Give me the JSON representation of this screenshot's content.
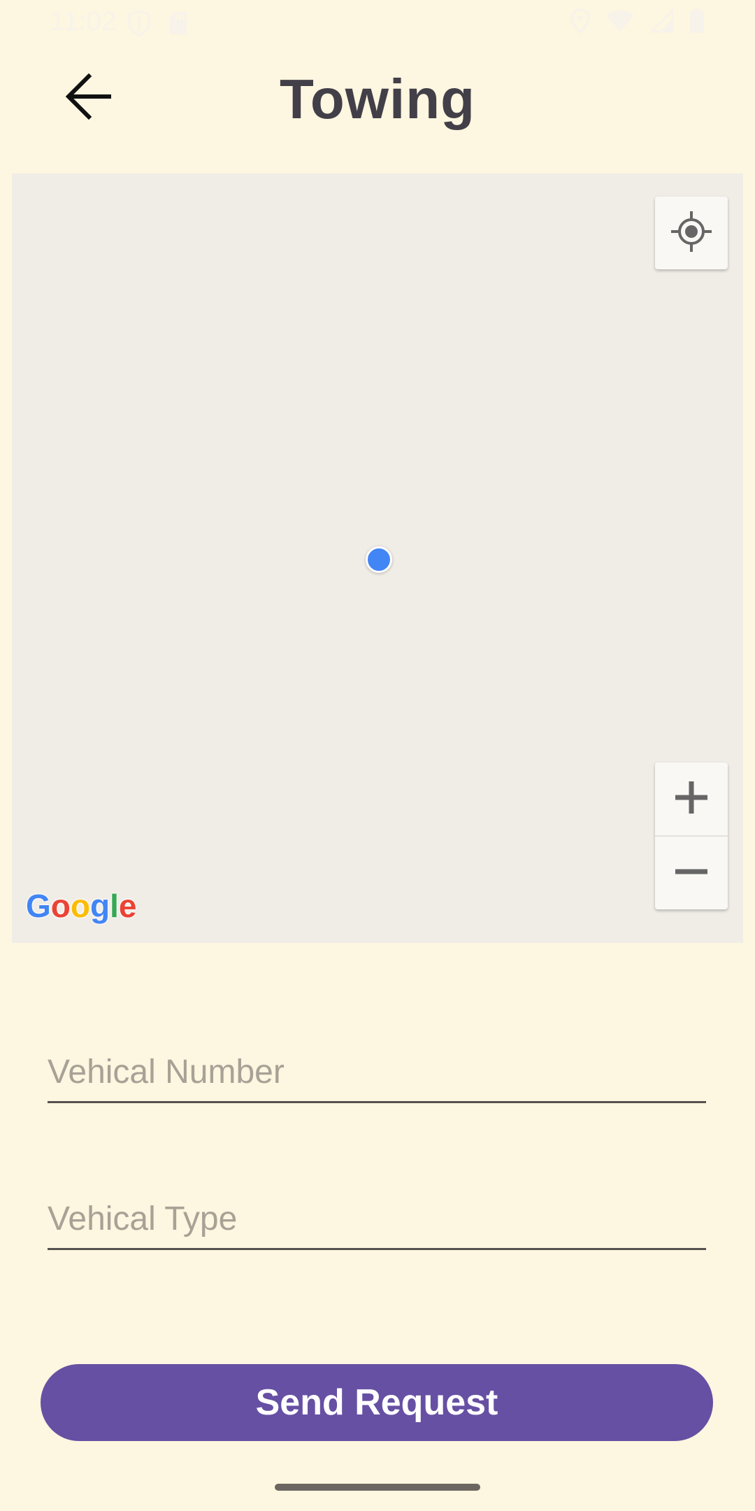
{
  "status_bar": {
    "time": "11:02",
    "left_icons": [
      "shield-icon",
      "sd-card-icon"
    ],
    "right_icons": [
      "location-pin-icon",
      "wifi-icon",
      "signal-icon",
      "battery-icon"
    ]
  },
  "app_bar": {
    "back_icon": "arrow-back-icon",
    "title": "Towing"
  },
  "map": {
    "my_location_icon": "crosshair-icon",
    "zoom_in_icon": "plus-icon",
    "zoom_out_icon": "minus-icon",
    "logo_text": "Google",
    "user_dot_color": "#4285F4",
    "background_color": "#F0EDE6"
  },
  "form": {
    "vehicle_number": {
      "placeholder": "Vehical Number",
      "value": ""
    },
    "vehicle_type": {
      "placeholder": "Vehical Type",
      "value": ""
    }
  },
  "actions": {
    "send_label": "Send Request",
    "send_color": "#6650A3"
  },
  "theme": {
    "background": "#FDF6E0",
    "title_color": "#423F48"
  }
}
